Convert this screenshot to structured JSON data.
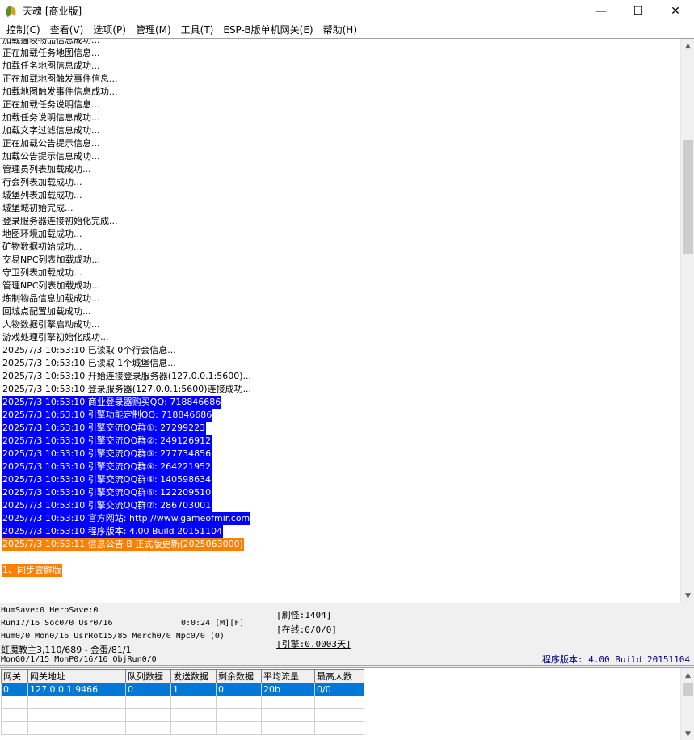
{
  "window": {
    "title": "天魂 [商业版]",
    "minimize": "—",
    "maximize": "☐",
    "close": "✕"
  },
  "menu": [
    {
      "label": "控制(C)"
    },
    {
      "label": "查看(V)"
    },
    {
      "label": "选项(P)"
    },
    {
      "label": "管理(M)"
    },
    {
      "label": "工具(T)"
    },
    {
      "label": "ESP-B版单机网关(E)"
    },
    {
      "label": "帮助(H)"
    }
  ],
  "log": {
    "lines": [
      "加载描裂物品信息成功...",
      "正在加载任务地图信息...",
      "加载任务地图信息成功...",
      "正在加载地图触发事件信息...",
      "加载地图触发事件信息成功...",
      "正在加载任务说明信息...",
      "加载任务说明信息成功...",
      "加载文字过滤信息成功...",
      "正在加载公告提示信息...",
      "加载公告提示信息成功...",
      "管理员列表加载成功...",
      "行会列表加载成功...",
      "城堡列表加载成功...",
      "城堡城初始完成...",
      "登录服务器连接初始化完成...",
      "地图环境加载成功...",
      "矿物数据初始成功...",
      "交易NPC列表加载成功...",
      "守卫列表加载成功...",
      "管理NPC列表加载成功...",
      "炼制物品信息加载成功...",
      "回城点配置加载成功...",
      "人物数据引擎启动成功...",
      "游戏处理引擎初始化成功...",
      "2025/7/3 10:53:10 已读取 0个行会信息...",
      "2025/7/3 10:53:10 已读取 1个城堡信息...",
      "2025/7/3 10:53:10 开始连接登录服务器(127.0.0.1:5600)...",
      "2025/7/3 10:53:10 登录服务器(127.0.0.1:5600)连接成功..."
    ],
    "blue_lines": [
      "2025/7/3 10:53:10 商业登录器购买QQ: 718846686",
      "2025/7/3 10:53:10 引擎功能定制QQ: 718846686",
      "2025/7/3 10:53:10 引擎交流QQ群①: 27299223",
      "2025/7/3 10:53:10 引擎交流QQ群②: 249126912",
      "2025/7/3 10:53:10 引擎交流QQ群③: 277734856",
      "2025/7/3 10:53:10 引擎交流QQ群④: 264221952",
      "2025/7/3 10:53:10 引擎交流QQ群④: 140598634",
      "2025/7/3 10:53:10 引擎交流QQ群⑥: 122209510",
      "2025/7/3 10:53:10 引擎交流QQ群⑦: 286703001",
      "2025/7/3 10:53:10 官方网站: http://www.gameofmir.com",
      "2025/7/3 10:53:10 程序版本: 4.00 Build 20151104"
    ],
    "orange_lines": [
      "2025/7/3 10:53:11 信息公告 B 正式版更新(2025063000)",
      "1、同步尝鲜版"
    ]
  },
  "status": {
    "line1": "HumSave:0 HeroSave:0",
    "line2": "Run17/16 Soc0/0 Usr0/16",
    "time": "0:0:24 [M][F]",
    "line3": "Hum0/0 Mon0/16 UsrRot15/85 Merch0/0 Npc0/0 (0)",
    "line4": "虹魔教主3,110/689 - 金蛋/81/1",
    "line5": "MonG0/1/15 MonP0/16/16 ObjRun0/0",
    "refresh": "[刷怪:1404]",
    "online": "[在线:0/0/0]",
    "engine": "[引擎:0.0003天]",
    "version": "程序版本: 4.00 Build 20151104"
  },
  "grid": {
    "headers": [
      "网关",
      "网关地址",
      "队列数据",
      "发送数据",
      "剩余数据",
      "平均流量",
      "最高人数"
    ],
    "rows": [
      [
        "0",
        "127.0.0.1:9466",
        "0",
        "1",
        "0",
        "20b",
        "0/0"
      ]
    ]
  }
}
